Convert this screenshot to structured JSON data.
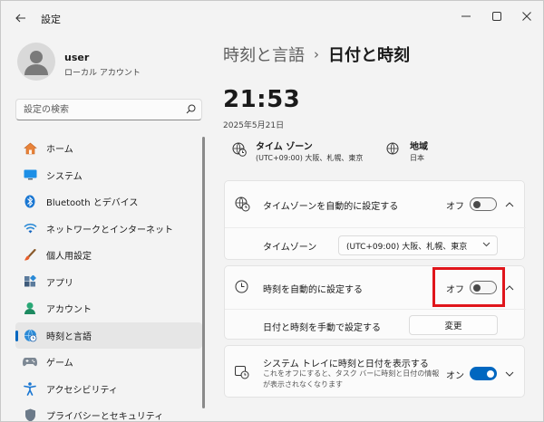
{
  "window": {
    "title": "設定"
  },
  "user": {
    "name": "user",
    "account_type": "ローカル アカウント"
  },
  "search": {
    "placeholder": "設定の検索"
  },
  "sidebar": {
    "items": [
      {
        "label": "ホーム",
        "icon": "home-icon",
        "active": false
      },
      {
        "label": "システム",
        "icon": "display-icon",
        "active": false
      },
      {
        "label": "Bluetooth とデバイス",
        "icon": "bluetooth-icon",
        "active": false
      },
      {
        "label": "ネットワークとインターネット",
        "icon": "wifi-icon",
        "active": false
      },
      {
        "label": "個人用設定",
        "icon": "brush-icon",
        "active": false
      },
      {
        "label": "アプリ",
        "icon": "apps-icon",
        "active": false
      },
      {
        "label": "アカウント",
        "icon": "person-icon",
        "active": false
      },
      {
        "label": "時刻と言語",
        "icon": "globe-clock-icon",
        "active": true
      },
      {
        "label": "ゲーム",
        "icon": "gamepad-icon",
        "active": false
      },
      {
        "label": "アクセシビリティ",
        "icon": "accessibility-icon",
        "active": false
      },
      {
        "label": "プライバシーとセキュリティ",
        "icon": "shield-icon",
        "active": false
      }
    ]
  },
  "breadcrumb": {
    "parent": "時刻と言語",
    "separator": "›",
    "current": "日付と時刻"
  },
  "clock": {
    "time": "21:53",
    "date": "2025年5月21日"
  },
  "timezone_info": {
    "label": "タイム ゾーン",
    "value": "(UTC+09:00) 大阪、札幌、東京"
  },
  "region_info": {
    "label": "地域",
    "value": "日本"
  },
  "settings": {
    "auto_timezone": {
      "title": "タイムゾーンを自動的に設定する",
      "state_label": "オフ",
      "on": false
    },
    "timezone_select": {
      "label": "タイムゾーン",
      "value": "(UTC+09:00) 大阪、札幌、東京"
    },
    "auto_time": {
      "title": "時刻を自動的に設定する",
      "state_label": "オフ",
      "on": false
    },
    "manual_time": {
      "label": "日付と時刻を手動で設定する",
      "button": "変更"
    },
    "tray_time": {
      "title": "システム トレイに時刻と日付を表示する",
      "description": "これをオフにすると、タスク バーに時刻と日付の情報が表示されなくなります",
      "state_label": "オン",
      "on": true
    }
  },
  "colors": {
    "accent": "#0067c0",
    "highlight": "#e0151b"
  }
}
